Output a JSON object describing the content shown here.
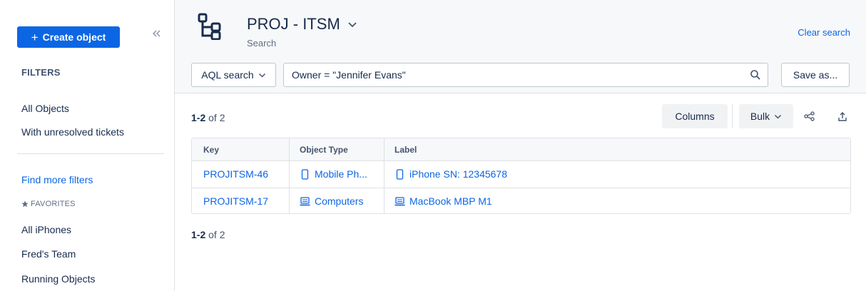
{
  "sidebar": {
    "create_label": "Create object",
    "filters_heading": "FILTERS",
    "filters": [
      "All Objects",
      "With unresolved tickets"
    ],
    "find_more": "Find more filters",
    "favorites_heading": "FAVORITES",
    "favorites": [
      "All iPhones",
      "Fred's Team",
      "Running Objects"
    ]
  },
  "header": {
    "title": "PROJ - ITSM",
    "subtitle": "Search",
    "clear_search": "Clear search"
  },
  "search": {
    "mode_label": "AQL search",
    "query": "Owner = \"Jennifer Evans\"",
    "save_as": "Save as..."
  },
  "results": {
    "range": "1-2",
    "suffix": "of 2"
  },
  "toolbar": {
    "columns": "Columns",
    "bulk": "Bulk"
  },
  "table": {
    "headers": [
      "Key",
      "Object Type",
      "Label"
    ],
    "rows": [
      {
        "key": "PROJITSM-46",
        "type": "Mobile Ph...",
        "type_icon": "mobile-phone-icon",
        "label": "iPhone SN: 12345678",
        "label_icon": "mobile-phone-icon"
      },
      {
        "key": "PROJITSM-17",
        "type": "Computers",
        "type_icon": "laptop-icon",
        "label": "MacBook MBP M1",
        "label_icon": "laptop-icon"
      }
    ]
  },
  "colors": {
    "accent": "#0c66e4",
    "text": "#172b4d",
    "subtle": "#44546f",
    "border": "#dfe1e6",
    "header_bg": "#f7f8f9"
  }
}
